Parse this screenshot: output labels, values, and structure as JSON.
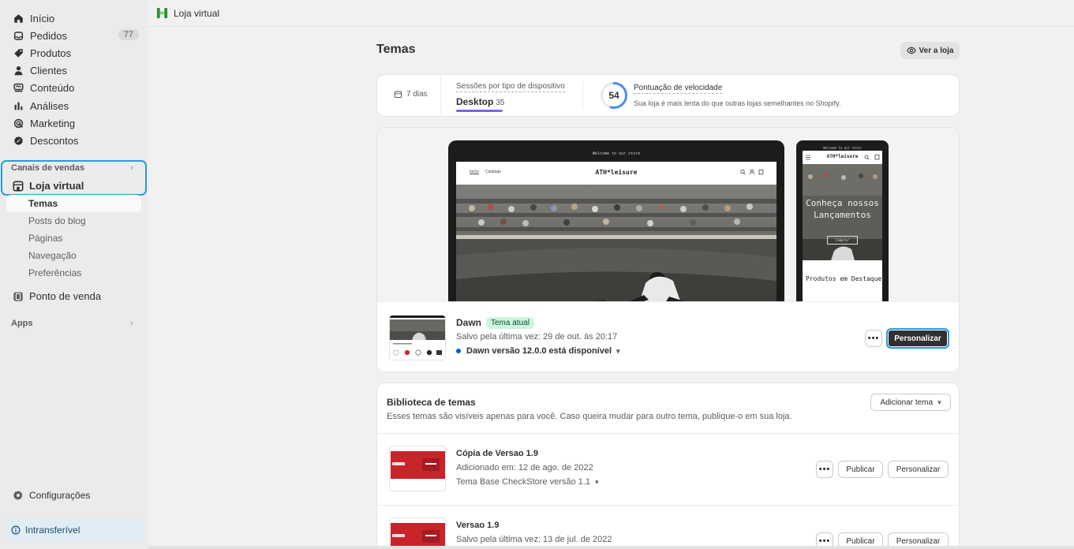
{
  "topbar": {
    "store_icon": "store-icon",
    "title": "Loja virtual"
  },
  "sidebar": {
    "items": [
      {
        "label": "Início",
        "icon": "home-icon"
      },
      {
        "label": "Pedidos",
        "icon": "inbox-icon",
        "badge": "77"
      },
      {
        "label": "Produtos",
        "icon": "tag-icon"
      },
      {
        "label": "Clientes",
        "icon": "person-icon"
      },
      {
        "label": "Conteúdo",
        "icon": "content-icon"
      },
      {
        "label": "Análises",
        "icon": "bar-chart-icon"
      },
      {
        "label": "Marketing",
        "icon": "target-icon"
      },
      {
        "label": "Descontos",
        "icon": "discount-icon"
      }
    ],
    "sales_channels_label": "Canais de vendas",
    "online_store": "Loja virtual",
    "sub_items": [
      "Temas",
      "Posts do blog",
      "Páginas",
      "Navegação",
      "Preferências"
    ],
    "pos": "Ponto de venda",
    "apps_label": "Apps",
    "settings": "Configurações",
    "non_transferable": "Intransferível"
  },
  "page": {
    "title": "Temas",
    "view_store": "Ver a loja"
  },
  "stats": {
    "period": "7 dias",
    "sessions_label": "Sessões por tipo de dispositivo",
    "device": "Desktop",
    "device_count": "35",
    "speed_score": 54,
    "speed_title": "Pontuação de velocidade",
    "speed_desc": "Sua loja é mais lenta do que outras lojas semelhantes no Shopify."
  },
  "preview": {
    "desktop_announce": "Welcome to our store",
    "desktop_nav": [
      "Início",
      "Catálogo"
    ],
    "logo": "ATH*leisure",
    "mobile_announce": "Welcome to our store",
    "mobile_hero": "Conheça nossos Lançamentos",
    "mobile_button": "Comprar",
    "mobile_featured": "Produtos em Destaque"
  },
  "current_theme": {
    "name": "Dawn",
    "tag": "Tema atual",
    "saved": "Salvo pela última vez: 29 de out. às 20:17",
    "version": "Dawn versão 12.0.0 está disponível",
    "customize": "Personalizar",
    "more": "•••"
  },
  "library": {
    "title": "Biblioteca de temas",
    "description": "Esses temas são visíveis apenas para você. Caso queira mudar para outro tema, publique-o em sua loja.",
    "add_theme": "Adicionar tema",
    "themes": [
      {
        "name": "Cópia de Versao 1.9",
        "date": "Adicionado em: 12 de ago. de 2022",
        "version": "Tema Base CheckStore versão 1.1",
        "publish": "Publicar",
        "customize": "Personalizar",
        "more": "•••"
      },
      {
        "name": "Versao 1.9",
        "date": "Salvo pela última vez: 13 de jul. de 2022",
        "publish": "Publicar",
        "customize": "Personalizar",
        "more": "•••"
      }
    ]
  },
  "colors": {
    "accent_focus": "#2c9bd6",
    "primary_button": "#303030",
    "tag_bg": "#cdf4dd",
    "speed_ring": "#4a8ef7",
    "device_underline": "#7b61ff"
  }
}
